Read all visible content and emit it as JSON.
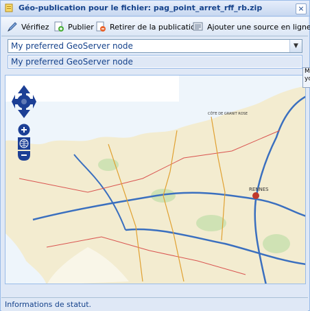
{
  "window": {
    "title": "Géo-publication pour le fichier: pag_point_arret_rff_rb.zip",
    "close_label": "×"
  },
  "toolbar": {
    "verify_label": "Vérifiez",
    "publish_label": "Publier",
    "unpublish_label": "Retirer de la publication",
    "add_source_label": "Ajouter une source en ligne."
  },
  "node_selector": {
    "value": "My preferred GeoServer node",
    "options": [
      "My preferred GeoServer node"
    ]
  },
  "tooltip": {
    "text": "M yo"
  },
  "map": {
    "icons": [
      "pan-icon",
      "zoom-in-icon",
      "zoom-world-icon",
      "zoom-out-icon"
    ],
    "labels": [
      "RENNES",
      "CÔTE DE GRANIT ROSE"
    ]
  },
  "status": {
    "text": "Informations de statut."
  },
  "colors": {
    "accent": "#15428b",
    "border": "#99bbe8",
    "panel": "#dfe8f6",
    "nav": "#1c3f95"
  }
}
